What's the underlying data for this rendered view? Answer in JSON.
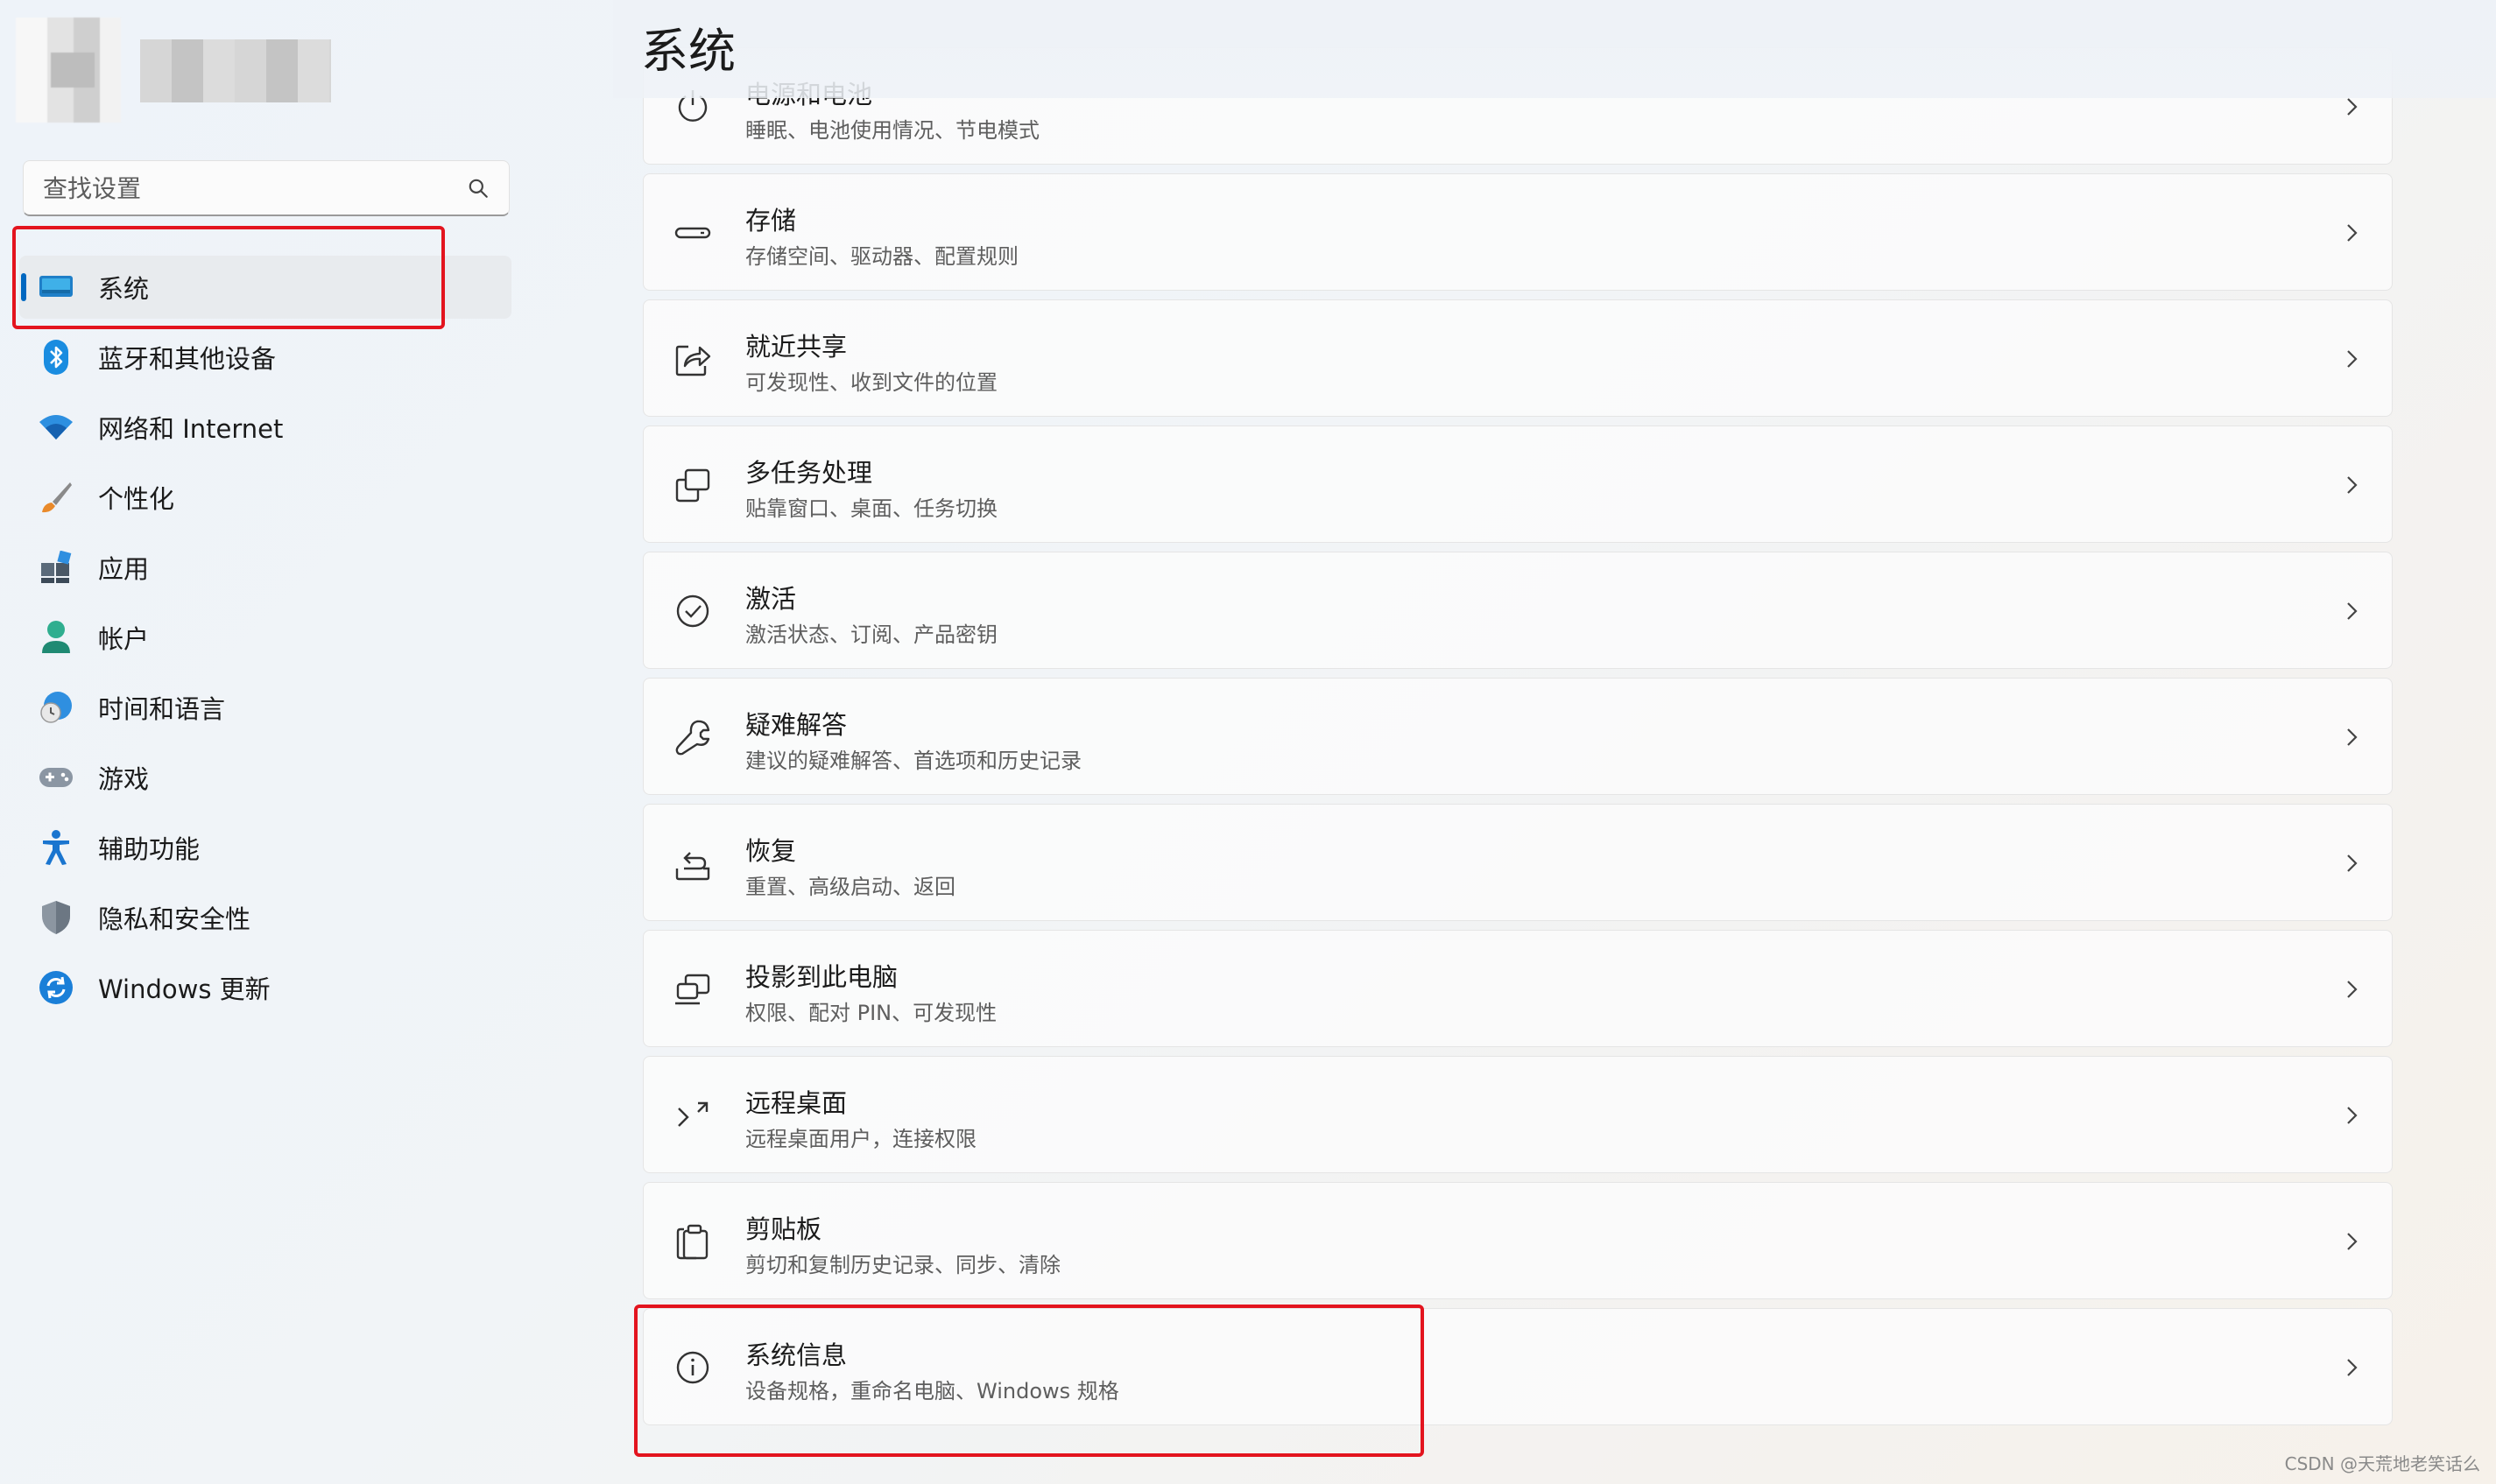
{
  "search": {
    "placeholder": "查找设置"
  },
  "sidebar": {
    "items": [
      {
        "label": "系统",
        "icon": "system-icon",
        "active": true
      },
      {
        "label": "蓝牙和其他设备",
        "icon": "bluetooth-icon"
      },
      {
        "label": "网络和 Internet",
        "icon": "wifi-icon"
      },
      {
        "label": "个性化",
        "icon": "brush-icon"
      },
      {
        "label": "应用",
        "icon": "apps-icon"
      },
      {
        "label": "帐户",
        "icon": "account-icon"
      },
      {
        "label": "时间和语言",
        "icon": "time-language-icon"
      },
      {
        "label": "游戏",
        "icon": "gamepad-icon"
      },
      {
        "label": "辅助功能",
        "icon": "accessibility-icon"
      },
      {
        "label": "隐私和安全性",
        "icon": "shield-icon"
      },
      {
        "label": "Windows 更新",
        "icon": "update-icon"
      }
    ]
  },
  "main": {
    "title": "系统",
    "cards": [
      {
        "title": "电源和电池",
        "subtitle": "睡眠、电池使用情况、节电模式",
        "icon": "power-icon"
      },
      {
        "title": "存储",
        "subtitle": "存储空间、驱动器、配置规则",
        "icon": "storage-icon"
      },
      {
        "title": "就近共享",
        "subtitle": "可发现性、收到文件的位置",
        "icon": "share-icon"
      },
      {
        "title": "多任务处理",
        "subtitle": "贴靠窗口、桌面、任务切换",
        "icon": "multitasking-icon"
      },
      {
        "title": "激活",
        "subtitle": "激活状态、订阅、产品密钥",
        "icon": "check-circle-icon"
      },
      {
        "title": "疑难解答",
        "subtitle": "建议的疑难解答、首选项和历史记录",
        "icon": "wrench-icon"
      },
      {
        "title": "恢复",
        "subtitle": "重置、高级启动、返回",
        "icon": "recovery-icon"
      },
      {
        "title": "投影到此电脑",
        "subtitle": "权限、配对 PIN、可发现性",
        "icon": "projection-icon"
      },
      {
        "title": "远程桌面",
        "subtitle": "远程桌面用户，连接权限",
        "icon": "remote-desktop-icon"
      },
      {
        "title": "剪贴板",
        "subtitle": "剪切和复制历史记录、同步、清除",
        "icon": "clipboard-icon"
      },
      {
        "title": "系统信息",
        "subtitle": "设备规格，重命名电脑、Windows 规格",
        "icon": "info-icon"
      }
    ]
  },
  "watermark": "CSDN @天荒地老笑话么",
  "colors": {
    "accent": "#0067c0",
    "highlight": "#e3141e"
  }
}
